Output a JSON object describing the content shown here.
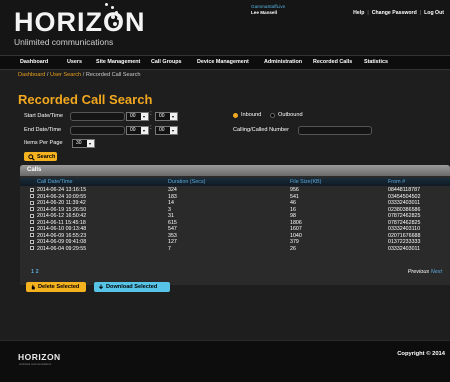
{
  "brand": {
    "name": "HORIZON",
    "tagline": "Unlimited communications",
    "footer_name": "HORIZON",
    "footer_sub": "unlimited communications"
  },
  "user": {
    "role": "GammaStaffLive",
    "name": "Lee Mansell"
  },
  "top_links": [
    "Help",
    "Change Password",
    "Log Out"
  ],
  "nav": [
    "Dashboard",
    "Users",
    "Site Management",
    "Call Groups",
    "Device Management",
    "Administration",
    "Recorded Calls",
    "Statistics"
  ],
  "breadcrumb": {
    "a": "Dashboard",
    "b": "User Search",
    "current": "Recorded Call Search"
  },
  "page_title": "Recorded Call Search",
  "form": {
    "start_label": "Start Date/Time",
    "end_label": "End Date/Time",
    "items_label": "Items Per Page",
    "items_value": "30",
    "hour": "00",
    "minute": "00",
    "inbound_label": "Inbound",
    "outbound_label": "Outbound",
    "calling_label": "Calling/Called Number",
    "search_label": "Search"
  },
  "calls": {
    "title": "Calls",
    "columns": [
      "Call Date/Time",
      "Duration (Secs)",
      "File Size(KB)",
      "From #"
    ],
    "rows": [
      [
        "2014-06-24 13:16:15",
        "324",
        "956",
        "08448118787"
      ],
      [
        "2014-06-24 10:09:55",
        "183",
        "541",
        "03454504502"
      ],
      [
        "2014-06-20 11:39:42",
        "14",
        "46",
        "03332403011"
      ],
      [
        "2014-06-19 15:26:50",
        "3",
        "16",
        "02380386586"
      ],
      [
        "2014-06-12 16:50:42",
        "31",
        "98",
        "07872462825"
      ],
      [
        "2014-06-11 15:45:18",
        "615",
        "1806",
        "07872462825"
      ],
      [
        "2014-06-10 09:13:48",
        "547",
        "1607",
        "03332403110"
      ],
      [
        "2014-06-09 16:55:23",
        "353",
        "1040",
        "02071676688"
      ],
      [
        "2014-06-09 09:41:08",
        "127",
        "379",
        "01372233333"
      ],
      [
        "2014-06-04 09:29:55",
        "7",
        "26",
        "03332403011"
      ]
    ],
    "pages": "1 2",
    "previous": "Previous",
    "next": "Next"
  },
  "actions": {
    "delete": "Delete Selected",
    "download": "Download Selected"
  },
  "copyright": "Copyright © 2014",
  "colors": {
    "accent": "#f2a81f",
    "link_blue": "#5aa7d8",
    "download_btn": "#57c3e6"
  }
}
